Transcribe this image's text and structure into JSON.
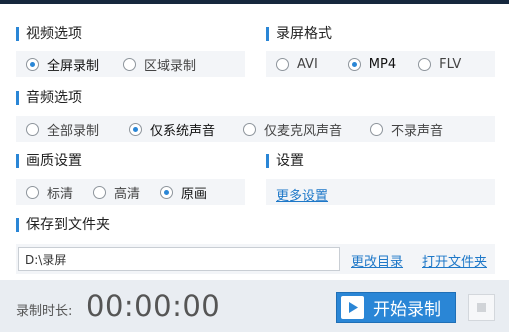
{
  "video": {
    "title": "视频选项",
    "options": [
      "全屏录制",
      "区域录制"
    ],
    "selected": "全屏录制"
  },
  "format": {
    "title": "录屏格式",
    "options": [
      "AVI",
      "MP4",
      "FLV"
    ],
    "selected": "MP4"
  },
  "audio": {
    "title": "音频选项",
    "options": [
      "全部录制",
      "仅系统声音",
      "仅麦克风声音",
      "不录声音"
    ],
    "selected": "仅系统声音"
  },
  "quality": {
    "title": "画质设置",
    "options": [
      "标清",
      "高清",
      "原画"
    ],
    "selected": "原画"
  },
  "settings": {
    "title": "设置",
    "more_link": "更多设置"
  },
  "save": {
    "title": "保存到文件夹",
    "path_value": "D:\\录屏",
    "change_dir_link": "更改目录",
    "open_folder_link": "打开文件夹"
  },
  "footer": {
    "duration_label": "录制时长:",
    "timer": "00:00:00",
    "start_label": "开始录制"
  },
  "colors": {
    "accent": "#2a86d6",
    "band": "#f3f5f8",
    "footer": "#e9edf2",
    "link": "#1e78c8"
  }
}
